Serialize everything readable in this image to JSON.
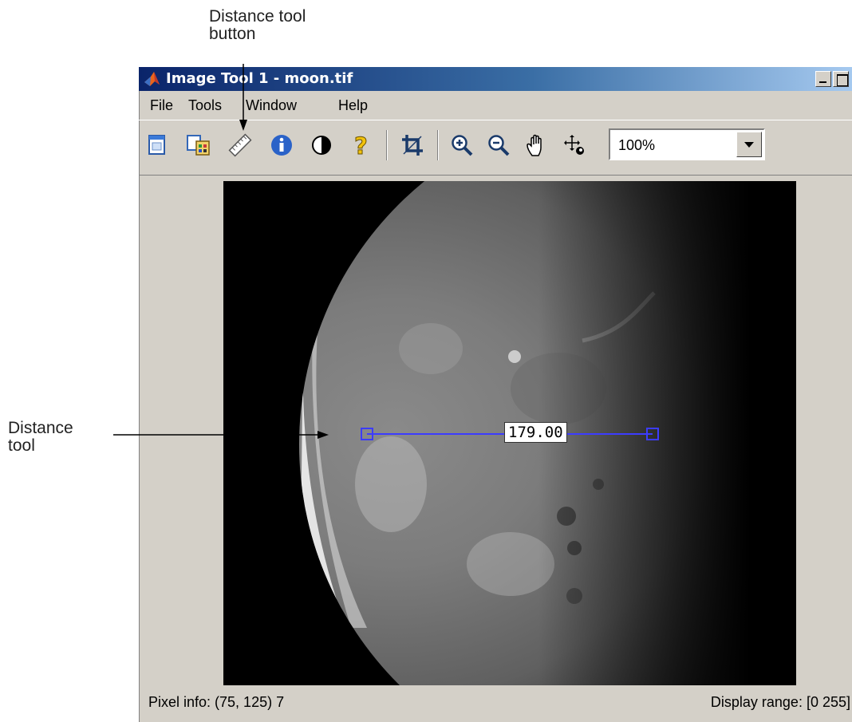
{
  "callouts": {
    "button_line1": "Distance tool",
    "button_line2": "button",
    "tool_line1": "Distance",
    "tool_line2": "tool"
  },
  "window": {
    "title": "Image Tool 1 - moon.tif"
  },
  "menu": {
    "items": [
      "File",
      "Tools",
      "Window",
      "Help"
    ]
  },
  "toolbar": {
    "icons": [
      "new-figure-icon",
      "export-icon",
      "distance-tool-icon",
      "info-icon",
      "contrast-icon",
      "help-icon",
      "crop-icon",
      "zoom-in-icon",
      "zoom-out-icon",
      "pan-icon",
      "overview-icon"
    ],
    "zoom_value": "100%"
  },
  "image": {
    "distance_label": "179.00"
  },
  "status": {
    "pixel_info": "Pixel info: (75, 125)  7",
    "display_range": "Display range: [0 255]"
  },
  "colors": {
    "title_gradient_start": "#0a246a",
    "title_gradient_end": "#a6caf0",
    "window_face": "#d4d0c8",
    "distance_line": "#3c3cff"
  }
}
